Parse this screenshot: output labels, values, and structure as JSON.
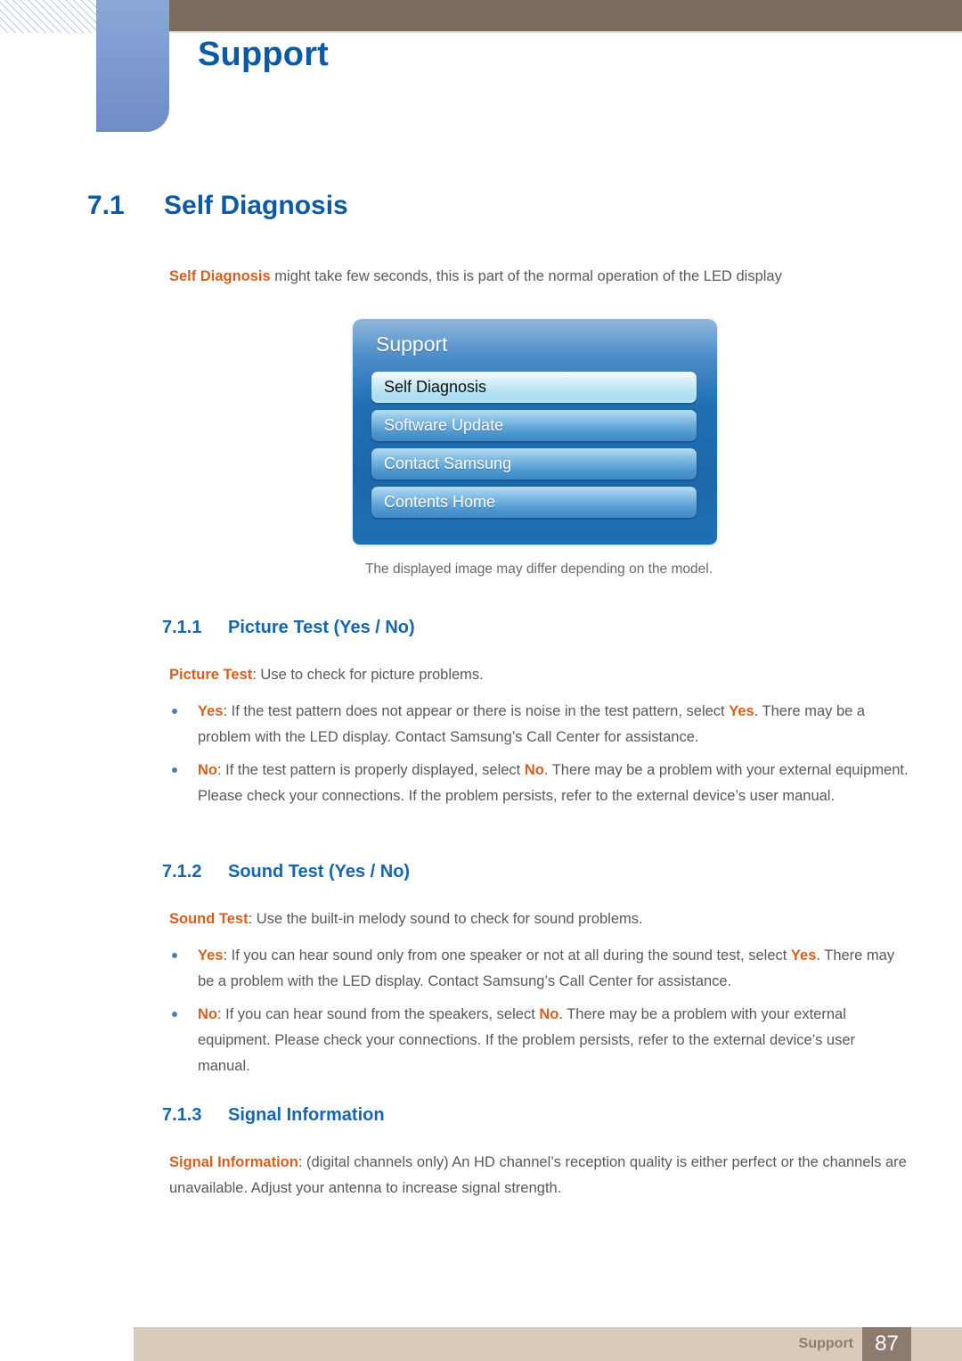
{
  "header": {
    "title": "Support"
  },
  "section": {
    "number": "7.1",
    "title": "Self Diagnosis",
    "intro_highlight": "Self Diagnosis",
    "intro_rest": " might take few seconds, this is part of the normal operation of the LED display"
  },
  "osd": {
    "title": "Support",
    "items": [
      {
        "label": "Self Diagnosis",
        "selected": true
      },
      {
        "label": "Software Update",
        "selected": false
      },
      {
        "label": "Contact Samsung",
        "selected": false
      },
      {
        "label": "Contents Home",
        "selected": false
      }
    ],
    "caption": "The displayed image may differ depending on the model."
  },
  "subsections": [
    {
      "number": "7.1.1",
      "title": "Picture Test (Yes / No)",
      "lead_highlight": "Picture Test",
      "lead_rest": ": Use to check for picture problems.",
      "bullets": [
        {
          "term": "Yes",
          "text_a": ": If the test pattern does not appear or there is noise in the test pattern, select ",
          "emphasis": "Yes",
          "text_b": ". There may be a problem with the LED display. Contact Samsung’s Call Center for assistance."
        },
        {
          "term": "No",
          "text_a": ": If the test pattern is properly displayed, select ",
          "emphasis": "No",
          "text_b": ". There may be a problem with your external equipment. Please check your connections. If the problem persists, refer to the external device’s user manual."
        }
      ]
    },
    {
      "number": "7.1.2",
      "title": "Sound Test (Yes / No)",
      "lead_highlight": "Sound Test",
      "lead_rest": ": Use the built-in melody sound to check for sound problems.",
      "bullets": [
        {
          "term": "Yes",
          "text_a": ": If you can hear sound only from one speaker or not at all during the sound test, select ",
          "emphasis": "Yes",
          "text_b": ". There may be a problem with the LED display. Contact Samsung’s Call Center for assistance."
        },
        {
          "term": "No",
          "text_a": ": If you can hear sound from the speakers, select ",
          "emphasis": "No",
          "text_b": ". There may be a problem with your external equipment. Please check your connections. If the problem persists, refer to the external device’s user manual."
        }
      ]
    },
    {
      "number": "7.1.3",
      "title": "Signal Information",
      "lead_highlight": "Signal Information",
      "lead_rest": ": (digital channels only) An HD channel’s reception quality is either perfect or the channels are unavailable. Adjust your antenna to increase signal strength.",
      "bullets": []
    }
  ],
  "footer": {
    "label": "Support",
    "page": "87"
  },
  "colors": {
    "heading_blue": "#0c5aa6",
    "subheading_blue": "#1565b0",
    "accent_orange": "#d4601f",
    "body_gray": "#595959",
    "header_brown": "#7a6c5d",
    "tab_blue": "#7e9bd0",
    "footer_tan": "#d9cbb9",
    "footer_page_brown": "#8d7b70"
  }
}
